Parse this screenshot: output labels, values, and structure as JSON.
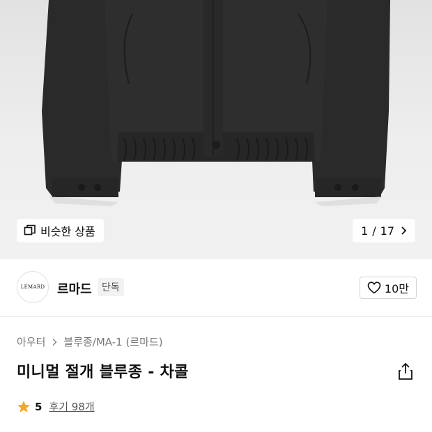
{
  "gallery": {
    "similar_label": "비슷한 상품",
    "page_current": "1",
    "page_separator": "/",
    "page_total": "17"
  },
  "brand": {
    "logo_text": "LEMARD",
    "name": "르마드",
    "badge": "단독",
    "like_count": "10만"
  },
  "breadcrumb": {
    "items": [
      "아우터",
      "블루종/MA-1 (르마드)"
    ]
  },
  "product": {
    "title": "미니멀 절개 블루종 - 차콜"
  },
  "rating": {
    "score": "5",
    "reviews_label": "후기 98개"
  },
  "colors": {
    "star": "#f5a623",
    "jacket": "#2b2b2b"
  },
  "icons": {
    "similar": "stacked-squares-icon",
    "pager_next": "chevron-right-icon",
    "like": "heart-outline-icon",
    "share": "share-icon",
    "star": "star-icon"
  }
}
